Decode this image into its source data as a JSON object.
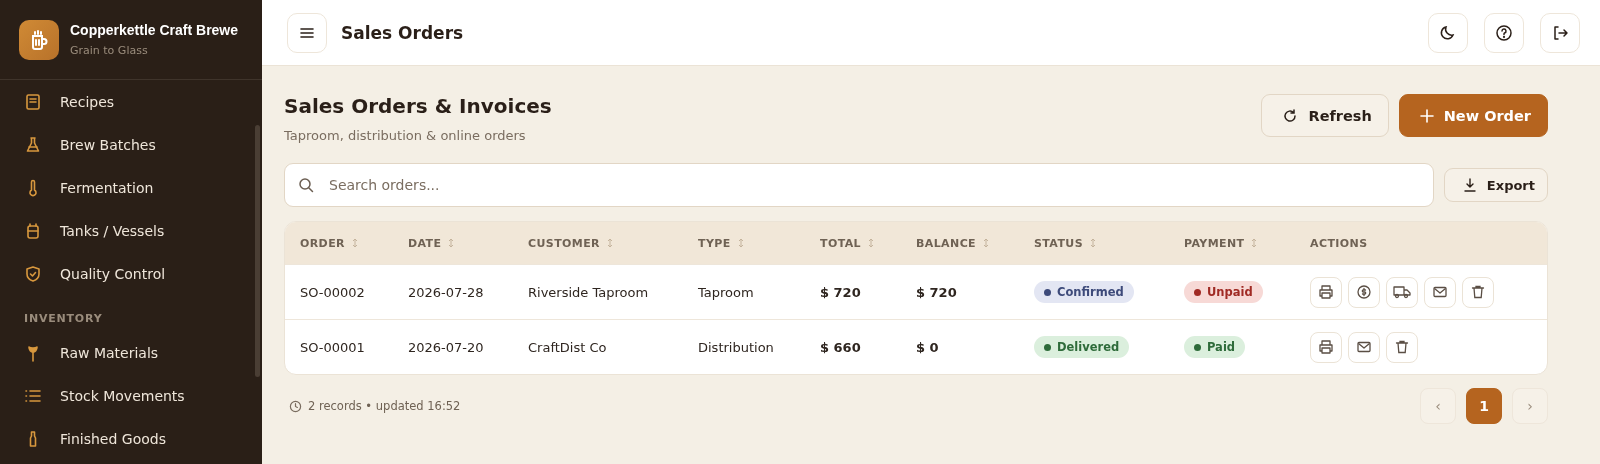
{
  "brand": {
    "name": "Copperkettle Craft Brewe",
    "tagline": "Grain to Glass"
  },
  "sidebar": {
    "items": [
      {
        "kind": "item",
        "label": "Recipes",
        "selected": false
      },
      {
        "kind": "item",
        "label": "Brew Batches",
        "selected": false
      },
      {
        "kind": "item",
        "label": "Fermentation",
        "selected": false
      },
      {
        "kind": "item",
        "label": "Tanks / Vessels",
        "selected": false
      },
      {
        "kind": "item",
        "label": "Quality Control",
        "selected": false
      },
      {
        "kind": "section",
        "label": "INVENTORY"
      },
      {
        "kind": "item",
        "label": "Raw Materials",
        "selected": false
      },
      {
        "kind": "item",
        "label": "Stock Movements",
        "selected": false
      },
      {
        "kind": "item",
        "label": "Finished Goods",
        "selected": false
      }
    ]
  },
  "topbar": {
    "title": "Sales Orders"
  },
  "page": {
    "title": "Sales Orders & Invoices",
    "subtitle": "Taproom, distribution & online orders",
    "refresh": "Refresh",
    "new_order": "New Order",
    "search": {
      "placeholder": "Search orders..."
    },
    "export": "Export"
  },
  "table": {
    "columns": [
      {
        "label": "ORDER",
        "sortable": true
      },
      {
        "label": "DATE",
        "sortable": true
      },
      {
        "label": "CUSTOMER",
        "sortable": true
      },
      {
        "label": "TYPE",
        "sortable": true
      },
      {
        "label": "TOTAL",
        "sortable": true
      },
      {
        "label": "BALANCE",
        "sortable": true
      },
      {
        "label": "STATUS",
        "sortable": true
      },
      {
        "label": "PAYMENT",
        "sortable": true
      },
      {
        "label": "ACTIONS",
        "sortable": false
      }
    ],
    "rows": [
      {
        "order": "SO-00002",
        "date": "2026-07-28",
        "customer": "Riverside Taproom",
        "type": "Taproom",
        "total": "$ 720",
        "balance": "$ 720",
        "status": {
          "label": "Confirmed",
          "color": "#3d4a7a"
        },
        "payment": {
          "label": "Unpaid",
          "color": "#a02a24"
        },
        "actions": [
          {
            "kind": "print"
          },
          {
            "kind": "payment"
          },
          {
            "kind": "ship"
          },
          {
            "kind": "email"
          },
          {
            "kind": "delete"
          }
        ]
      },
      {
        "order": "SO-00001",
        "date": "2026-07-20",
        "customer": "CraftDist Co",
        "type": "Distribution",
        "total": "$ 660",
        "balance": "$ 0",
        "status": {
          "label": "Delivered",
          "color": "#2e6b3a"
        },
        "payment": {
          "label": "Paid",
          "color": "#2e6b3a"
        },
        "actions": [
          {
            "kind": "print"
          },
          {
            "kind": "email"
          },
          {
            "kind": "delete"
          }
        ]
      }
    ]
  },
  "footer": {
    "info": "2 records • updated 16:52",
    "prev": "‹",
    "next": "›",
    "pages": [
      {
        "label": "1",
        "selected": true
      }
    ]
  }
}
